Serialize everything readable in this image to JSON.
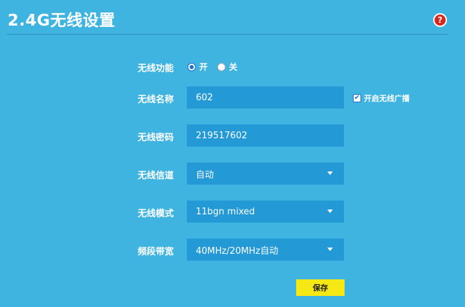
{
  "page": {
    "title": "2.4G无线设置",
    "help_icon": "question-mark-icon",
    "help_glyph": "?"
  },
  "colors": {
    "background": "#3fb4e0",
    "field": "#2399d6",
    "save_button": "#f5e814",
    "radio_accent": "#1a6fd1",
    "help_red": "#d9241c"
  },
  "wireless_function": {
    "label": "无线功能",
    "options": [
      {
        "label": "开",
        "checked": true
      },
      {
        "label": "关",
        "checked": false
      }
    ]
  },
  "ssid": {
    "label": "无线名称",
    "value": "602",
    "broadcast_label": "开启无线广播",
    "broadcast_checked": true
  },
  "password": {
    "label": "无线密码",
    "value": "219517602"
  },
  "channel": {
    "label": "无线信道",
    "value": "自动"
  },
  "mode": {
    "label": "无线模式",
    "value": "11bgn mixed"
  },
  "bandwidth": {
    "label": "频段带宽",
    "value": "40MHz/20MHz自动"
  },
  "actions": {
    "save_label": "保存"
  }
}
